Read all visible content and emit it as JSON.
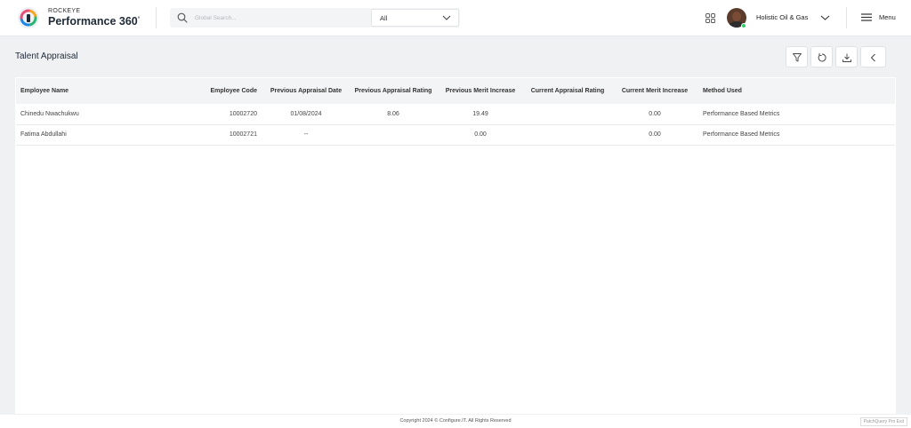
{
  "header": {
    "brand_top": "ROCKEYE",
    "brand_main": "Performance 360",
    "brand_sup": "°",
    "search_placeholder": "Global Search...",
    "scope_value": "All",
    "company": "Holistic Oil & Gas",
    "menu_label": "Menu"
  },
  "page": {
    "title": "Talent Appraisal"
  },
  "toolbar": {
    "icons": [
      "filter-icon",
      "refresh-icon",
      "download-icon",
      "back-icon"
    ]
  },
  "table": {
    "columns": [
      "Employee Name",
      "Employee Code",
      "Previous Appraisal Date",
      "Previous Appraisal Rating",
      "Previous Merit Increase",
      "Current Appraisal Rating",
      "Current Merit Increase",
      "Method Used"
    ],
    "rows": [
      [
        "Chinedu Nwachukwu",
        "10002720",
        "01/08/2024",
        "8.06",
        "19.49",
        "",
        "0.00",
        "Performance Based Metrics"
      ],
      [
        "Fatima Abdullahi",
        "10002721",
        "--",
        "",
        "0.00",
        "",
        "0.00",
        "Performance Based Metrics"
      ]
    ]
  },
  "footer": {
    "copyright": "Copyright 2024 © Configure.IT. All Rights Reserved",
    "version": "PatchQuery Pro Exit"
  },
  "colors": {
    "background": "#f0f1f3",
    "header_bg": "#ffffff",
    "table_head_bg": "#f3f4f6",
    "status_online": "#2ecc71"
  }
}
